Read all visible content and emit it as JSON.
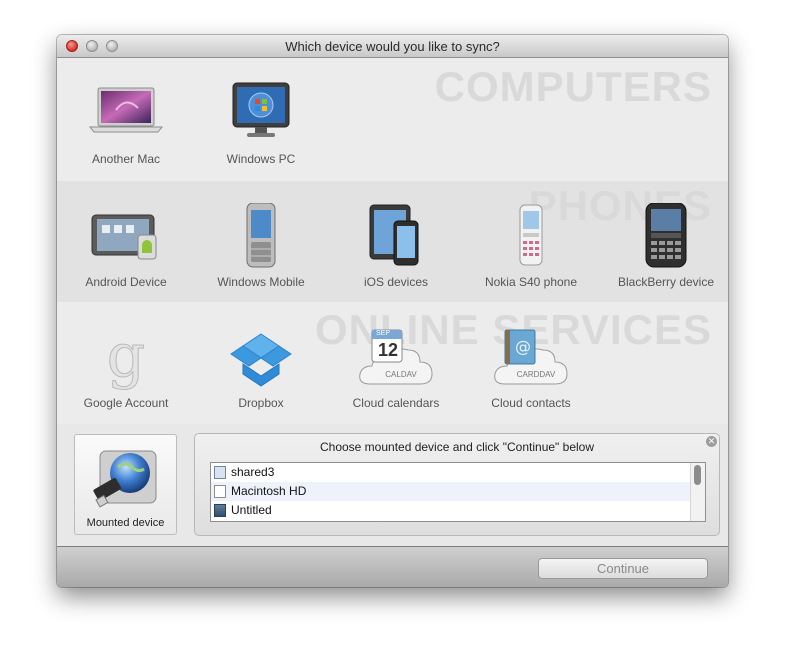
{
  "window": {
    "title": "Which device would you like to sync?"
  },
  "sections": {
    "computers": {
      "label": "COMPUTERS",
      "items": [
        {
          "label": "Another Mac",
          "icon": "macbook-icon"
        },
        {
          "label": "Windows PC",
          "icon": "windows-monitor-icon"
        }
      ]
    },
    "phones": {
      "label": "PHONES",
      "items": [
        {
          "label": "Android Device",
          "icon": "android-tablet-icon"
        },
        {
          "label": "Windows Mobile",
          "icon": "windows-mobile-phone-icon"
        },
        {
          "label": "iOS devices",
          "icon": "ios-devices-icon"
        },
        {
          "label": "Nokia S40 phone",
          "icon": "nokia-phone-icon"
        },
        {
          "label": "BlackBerry device",
          "icon": "blackberry-icon"
        }
      ]
    },
    "online": {
      "label": "ONLINE SERVICES",
      "items": [
        {
          "label": "Google Account",
          "icon": "google-g-icon"
        },
        {
          "label": "Dropbox",
          "icon": "dropbox-icon"
        },
        {
          "label": "Cloud calendars",
          "icon": "caldav-cloud-icon",
          "badge": "CALDAV",
          "cal_month": "SEP",
          "cal_day": "12"
        },
        {
          "label": "Cloud contacts",
          "icon": "carddav-cloud-icon",
          "badge": "CARDDAV"
        }
      ]
    }
  },
  "mounted": {
    "label": "Mounted device",
    "icon": "mounted-drive-globe-icon",
    "panel_title": "Choose mounted device and click \"Continue\" below",
    "close_glyph": "✕",
    "devices": [
      {
        "name": "shared3",
        "icon": "network-share-icon"
      },
      {
        "name": "Macintosh HD",
        "icon": "hard-drive-icon"
      },
      {
        "name": "Untitled",
        "icon": "removable-drive-icon"
      }
    ]
  },
  "footer": {
    "continue_label": "Continue"
  }
}
